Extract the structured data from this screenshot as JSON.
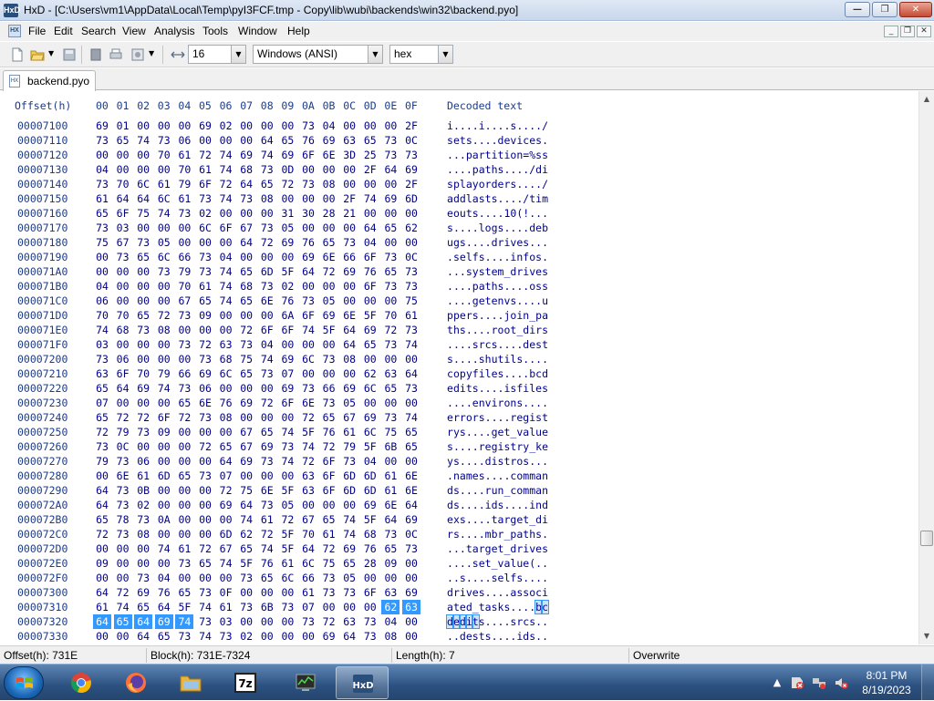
{
  "window": {
    "title": "HxD - [C:\\Users\\vm1\\AppData\\Local\\Temp\\pyI3FCF.tmp - Copy\\lib\\wubi\\backends\\win32\\backend.pyo]",
    "app_icon_text": "HxD",
    "minimize": "—",
    "maximize": "❐",
    "close": "✕"
  },
  "menu": {
    "items": [
      "File",
      "Edit",
      "Search",
      "View",
      "Analysis",
      "Tools",
      "Window",
      "Help"
    ],
    "mdi_min": "_",
    "mdi_restore": "❐",
    "mdi_close": "✕"
  },
  "toolbar": {
    "bytes_per_row": "16",
    "charset": "Windows (ANSI)",
    "offset_base": "hex"
  },
  "tab": {
    "label": "backend.pyo"
  },
  "hexview": {
    "offset_header": "Offset(h)",
    "column_headers": [
      "00",
      "01",
      "02",
      "03",
      "04",
      "05",
      "06",
      "07",
      "08",
      "09",
      "0A",
      "0B",
      "0C",
      "0D",
      "0E",
      "0F"
    ],
    "decoded_header": "Decoded text",
    "rows": [
      {
        "offset": "00007100",
        "bytes": [
          "69",
          "01",
          "00",
          "00",
          "00",
          "69",
          "02",
          "00",
          "00",
          "00",
          "73",
          "04",
          "00",
          "00",
          "00",
          "2F"
        ],
        "text": "i....i....s..../"
      },
      {
        "offset": "00007110",
        "bytes": [
          "73",
          "65",
          "74",
          "73",
          "06",
          "00",
          "00",
          "00",
          "64",
          "65",
          "76",
          "69",
          "63",
          "65",
          "73",
          "0C"
        ],
        "text": "sets....devices."
      },
      {
        "offset": "00007120",
        "bytes": [
          "00",
          "00",
          "00",
          "70",
          "61",
          "72",
          "74",
          "69",
          "74",
          "69",
          "6F",
          "6E",
          "3D",
          "25",
          "73",
          "73"
        ],
        "text": "...partition=%ss"
      },
      {
        "offset": "00007130",
        "bytes": [
          "04",
          "00",
          "00",
          "00",
          "70",
          "61",
          "74",
          "68",
          "73",
          "0D",
          "00",
          "00",
          "00",
          "2F",
          "64",
          "69"
        ],
        "text": "....paths..../di"
      },
      {
        "offset": "00007140",
        "bytes": [
          "73",
          "70",
          "6C",
          "61",
          "79",
          "6F",
          "72",
          "64",
          "65",
          "72",
          "73",
          "08",
          "00",
          "00",
          "00",
          "2F"
        ],
        "text": "splayorders..../"
      },
      {
        "offset": "00007150",
        "bytes": [
          "61",
          "64",
          "64",
          "6C",
          "61",
          "73",
          "74",
          "73",
          "08",
          "00",
          "00",
          "00",
          "2F",
          "74",
          "69",
          "6D"
        ],
        "text": "addlasts..../tim"
      },
      {
        "offset": "00007160",
        "bytes": [
          "65",
          "6F",
          "75",
          "74",
          "73",
          "02",
          "00",
          "00",
          "00",
          "31",
          "30",
          "28",
          "21",
          "00",
          "00",
          "00"
        ],
        "text": "eouts....10(!..."
      },
      {
        "offset": "00007170",
        "bytes": [
          "73",
          "03",
          "00",
          "00",
          "00",
          "6C",
          "6F",
          "67",
          "73",
          "05",
          "00",
          "00",
          "00",
          "64",
          "65",
          "62"
        ],
        "text": "s....logs....deb"
      },
      {
        "offset": "00007180",
        "bytes": [
          "75",
          "67",
          "73",
          "05",
          "00",
          "00",
          "00",
          "64",
          "72",
          "69",
          "76",
          "65",
          "73",
          "04",
          "00",
          "00"
        ],
        "text": "ugs....drives..."
      },
      {
        "offset": "00007190",
        "bytes": [
          "00",
          "73",
          "65",
          "6C",
          "66",
          "73",
          "04",
          "00",
          "00",
          "00",
          "69",
          "6E",
          "66",
          "6F",
          "73",
          "0C"
        ],
        "text": ".selfs....infos."
      },
      {
        "offset": "000071A0",
        "bytes": [
          "00",
          "00",
          "00",
          "73",
          "79",
          "73",
          "74",
          "65",
          "6D",
          "5F",
          "64",
          "72",
          "69",
          "76",
          "65",
          "73"
        ],
        "text": "...system_drives"
      },
      {
        "offset": "000071B0",
        "bytes": [
          "04",
          "00",
          "00",
          "00",
          "70",
          "61",
          "74",
          "68",
          "73",
          "02",
          "00",
          "00",
          "00",
          "6F",
          "73",
          "73"
        ],
        "text": "....paths....oss"
      },
      {
        "offset": "000071C0",
        "bytes": [
          "06",
          "00",
          "00",
          "00",
          "67",
          "65",
          "74",
          "65",
          "6E",
          "76",
          "73",
          "05",
          "00",
          "00",
          "00",
          "75"
        ],
        "text": "....getenvs....u"
      },
      {
        "offset": "000071D0",
        "bytes": [
          "70",
          "70",
          "65",
          "72",
          "73",
          "09",
          "00",
          "00",
          "00",
          "6A",
          "6F",
          "69",
          "6E",
          "5F",
          "70",
          "61"
        ],
        "text": "ppers....join_pa"
      },
      {
        "offset": "000071E0",
        "bytes": [
          "74",
          "68",
          "73",
          "08",
          "00",
          "00",
          "00",
          "72",
          "6F",
          "6F",
          "74",
          "5F",
          "64",
          "69",
          "72",
          "73"
        ],
        "text": "ths....root_dirs"
      },
      {
        "offset": "000071F0",
        "bytes": [
          "03",
          "00",
          "00",
          "00",
          "73",
          "72",
          "63",
          "73",
          "04",
          "00",
          "00",
          "00",
          "64",
          "65",
          "73",
          "74"
        ],
        "text": "....srcs....dest"
      },
      {
        "offset": "00007200",
        "bytes": [
          "73",
          "06",
          "00",
          "00",
          "00",
          "73",
          "68",
          "75",
          "74",
          "69",
          "6C",
          "73",
          "08",
          "00",
          "00",
          "00"
        ],
        "text": "s....shutils...."
      },
      {
        "offset": "00007210",
        "bytes": [
          "63",
          "6F",
          "70",
          "79",
          "66",
          "69",
          "6C",
          "65",
          "73",
          "07",
          "00",
          "00",
          "00",
          "62",
          "63",
          "64"
        ],
        "text": "copyfiles....bcd"
      },
      {
        "offset": "00007220",
        "bytes": [
          "65",
          "64",
          "69",
          "74",
          "73",
          "06",
          "00",
          "00",
          "00",
          "69",
          "73",
          "66",
          "69",
          "6C",
          "65",
          "73"
        ],
        "text": "edits....isfiles"
      },
      {
        "offset": "00007230",
        "bytes": [
          "07",
          "00",
          "00",
          "00",
          "65",
          "6E",
          "76",
          "69",
          "72",
          "6F",
          "6E",
          "73",
          "05",
          "00",
          "00",
          "00"
        ],
        "text": "....environs...."
      },
      {
        "offset": "00007240",
        "bytes": [
          "65",
          "72",
          "72",
          "6F",
          "72",
          "73",
          "08",
          "00",
          "00",
          "00",
          "72",
          "65",
          "67",
          "69",
          "73",
          "74"
        ],
        "text": "errors....regist"
      },
      {
        "offset": "00007250",
        "bytes": [
          "72",
          "79",
          "73",
          "09",
          "00",
          "00",
          "00",
          "67",
          "65",
          "74",
          "5F",
          "76",
          "61",
          "6C",
          "75",
          "65"
        ],
        "text": "rys....get_value"
      },
      {
        "offset": "00007260",
        "bytes": [
          "73",
          "0C",
          "00",
          "00",
          "00",
          "72",
          "65",
          "67",
          "69",
          "73",
          "74",
          "72",
          "79",
          "5F",
          "6B",
          "65"
        ],
        "text": "s....registry_ke"
      },
      {
        "offset": "00007270",
        "bytes": [
          "79",
          "73",
          "06",
          "00",
          "00",
          "00",
          "64",
          "69",
          "73",
          "74",
          "72",
          "6F",
          "73",
          "04",
          "00",
          "00"
        ],
        "text": "ys....distros..."
      },
      {
        "offset": "00007280",
        "bytes": [
          "00",
          "6E",
          "61",
          "6D",
          "65",
          "73",
          "07",
          "00",
          "00",
          "00",
          "63",
          "6F",
          "6D",
          "6D",
          "61",
          "6E"
        ],
        "text": ".names....comman"
      },
      {
        "offset": "00007290",
        "bytes": [
          "64",
          "73",
          "0B",
          "00",
          "00",
          "00",
          "72",
          "75",
          "6E",
          "5F",
          "63",
          "6F",
          "6D",
          "6D",
          "61",
          "6E"
        ],
        "text": "ds....run_comman"
      },
      {
        "offset": "000072A0",
        "bytes": [
          "64",
          "73",
          "02",
          "00",
          "00",
          "00",
          "69",
          "64",
          "73",
          "05",
          "00",
          "00",
          "00",
          "69",
          "6E",
          "64"
        ],
        "text": "ds....ids....ind"
      },
      {
        "offset": "000072B0",
        "bytes": [
          "65",
          "78",
          "73",
          "0A",
          "00",
          "00",
          "00",
          "74",
          "61",
          "72",
          "67",
          "65",
          "74",
          "5F",
          "64",
          "69"
        ],
        "text": "exs....target_di"
      },
      {
        "offset": "000072C0",
        "bytes": [
          "72",
          "73",
          "08",
          "00",
          "00",
          "00",
          "6D",
          "62",
          "72",
          "5F",
          "70",
          "61",
          "74",
          "68",
          "73",
          "0C"
        ],
        "text": "rs....mbr_paths."
      },
      {
        "offset": "000072D0",
        "bytes": [
          "00",
          "00",
          "00",
          "74",
          "61",
          "72",
          "67",
          "65",
          "74",
          "5F",
          "64",
          "72",
          "69",
          "76",
          "65",
          "73"
        ],
        "text": "...target_drives"
      },
      {
        "offset": "000072E0",
        "bytes": [
          "09",
          "00",
          "00",
          "00",
          "73",
          "65",
          "74",
          "5F",
          "76",
          "61",
          "6C",
          "75",
          "65",
          "28",
          "09",
          "00"
        ],
        "text": "....set_value(.."
      },
      {
        "offset": "000072F0",
        "bytes": [
          "00",
          "00",
          "73",
          "04",
          "00",
          "00",
          "00",
          "73",
          "65",
          "6C",
          "66",
          "73",
          "05",
          "00",
          "00",
          "00"
        ],
        "text": "..s....selfs...."
      },
      {
        "offset": "00007300",
        "bytes": [
          "64",
          "72",
          "69",
          "76",
          "65",
          "73",
          "0F",
          "00",
          "00",
          "00",
          "61",
          "73",
          "73",
          "6F",
          "63",
          "69"
        ],
        "text": "drives....associ"
      },
      {
        "offset": "00007310",
        "bytes": [
          "61",
          "74",
          "65",
          "64",
          "5F",
          "74",
          "61",
          "73",
          "6B",
          "73",
          "07",
          "00",
          "00",
          "00",
          "62",
          "63"
        ],
        "text": "ated_tasks....bc"
      },
      {
        "offset": "00007320",
        "bytes": [
          "64",
          "65",
          "64",
          "69",
          "74",
          "73",
          "03",
          "00",
          "00",
          "00",
          "73",
          "72",
          "63",
          "73",
          "04",
          "00"
        ],
        "text": "dedits....srcs.."
      },
      {
        "offset": "00007330",
        "bytes": [
          "00",
          "00",
          "64",
          "65",
          "73",
          "74",
          "73",
          "02",
          "00",
          "00",
          "00",
          "69",
          "64",
          "73",
          "08",
          "00"
        ],
        "text": "..dests....ids.."
      }
    ]
  },
  "status": {
    "offset": "Offset(h): 731E",
    "block": "Block(h): 731E-7324",
    "length": "Length(h): 7",
    "mode": "Overwrite"
  },
  "taskbar": {
    "apps": [
      "Google Chrome",
      "Firefox",
      "Windows Explorer",
      "7-Zip",
      "Task Manager",
      "HxD"
    ],
    "time": "8:01 PM",
    "date": "8/19/2023"
  },
  "colors": {
    "selection": "#3399ff",
    "hex_text": "#00008b",
    "header_text": "#1a3c8c"
  }
}
